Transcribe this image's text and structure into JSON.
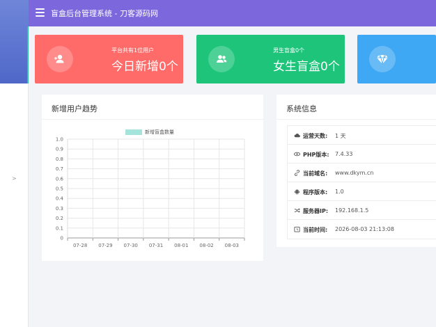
{
  "header": {
    "title": "盲盒后台管理系统 - 刀客源码网"
  },
  "cards": [
    {
      "sub": "平台共有1位用户",
      "main": "今日新增0个",
      "icon": "user-add-icon",
      "color": "#ff6b69"
    },
    {
      "sub": "男生盲盒0个",
      "main": "女生盲盒0个",
      "icon": "users-icon",
      "color": "#1dc47a"
    },
    {
      "sub": "",
      "main": "",
      "icon": "diamond-icon",
      "color": "#3fa8f4"
    }
  ],
  "chart_panel": {
    "title": "新增用户趋势"
  },
  "chart_data": {
    "type": "line",
    "legend": "新增盲盒数量",
    "legend_color": "#a5e3dc",
    "categories": [
      "07-28",
      "07-29",
      "07-30",
      "07-31",
      "08-01",
      "08-02",
      "08-03"
    ],
    "series": [
      {
        "name": "新增盲盒数量",
        "values": [
          0,
          0,
          0,
          0,
          0,
          0,
          0
        ]
      }
    ],
    "ylim": [
      0,
      1.0
    ],
    "yticks": [
      "0",
      "0.1",
      "0.2",
      "0.3",
      "0.4",
      "0.5",
      "0.6",
      "0.7",
      "0.8",
      "0.9",
      "1.0"
    ],
    "grid": true
  },
  "info_panel": {
    "title": "系统信息",
    "rows": [
      {
        "icon": "cloud-icon",
        "label": "运营天数:",
        "value": "1 天"
      },
      {
        "icon": "eye-icon",
        "label": "PHP版本:",
        "value": "7.4.33"
      },
      {
        "icon": "link-icon",
        "label": "当前域名:",
        "value": "www.dkym.cn"
      },
      {
        "icon": "android-icon",
        "label": "程序版本:",
        "value": "1.0"
      },
      {
        "icon": "shuffle-icon",
        "label": "服务器IP:",
        "value": "192.168.1.5"
      },
      {
        "icon": "clock-icon",
        "label": "当前时间:",
        "value": "2026-08-03 21:13:08"
      }
    ]
  }
}
